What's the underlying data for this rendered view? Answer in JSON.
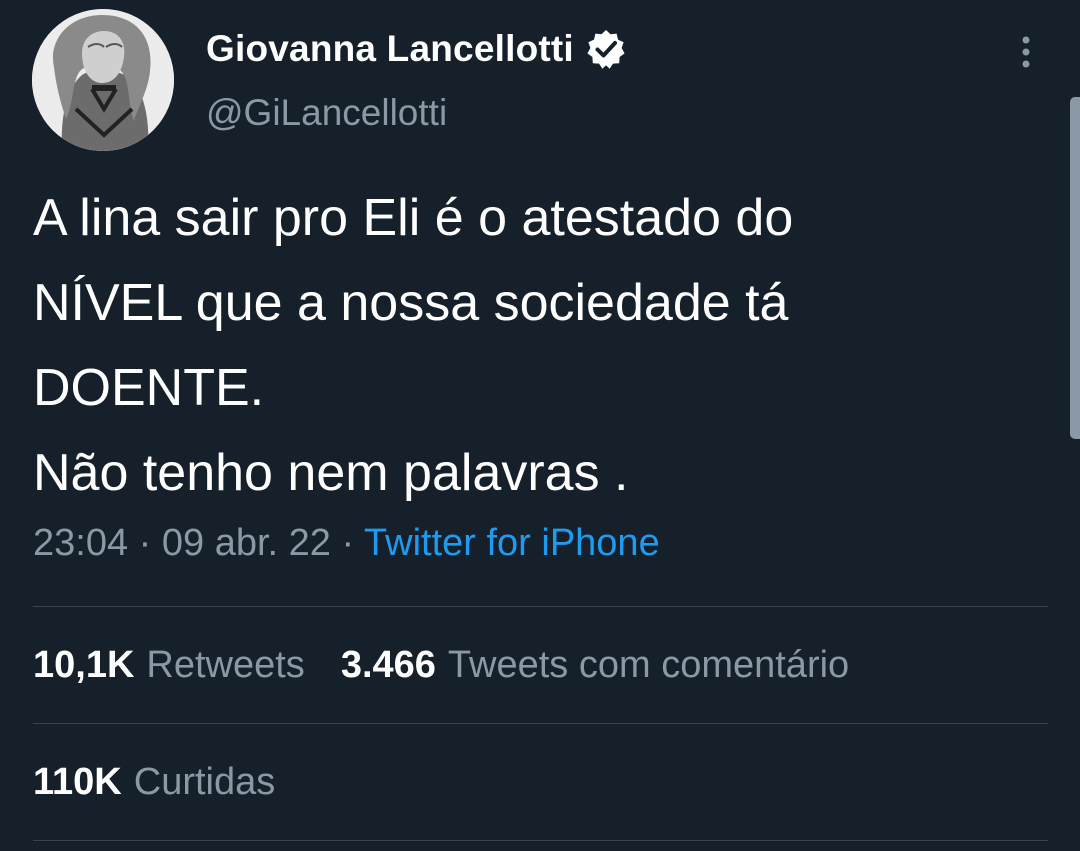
{
  "author": {
    "display_name": "Giovanna Lancellotti",
    "handle": "@GiLancellotti",
    "verified": true
  },
  "tweet": {
    "lines": [
      "A lina sair pro Eli é o atestado do",
      "NÍVEL que a nossa sociedade tá",
      "DOENTE.",
      "Não tenho nem palavras ."
    ],
    "time": "23:04",
    "date": "09 abr. 22",
    "separator": "·",
    "source": "Twitter for iPhone"
  },
  "stats": {
    "retweets_count": "10,1K",
    "retweets_label": "Retweets",
    "quotes_count": "3.466",
    "quotes_label": "Tweets com comentário",
    "likes_count": "110K",
    "likes_label": "Curtidas"
  },
  "colors": {
    "background": "#15202b",
    "secondary_text": "#8b98a5",
    "link": "#1d9bf0",
    "divider": "#38444d"
  },
  "icons": {
    "verified": "verified-badge-icon",
    "more": "more-vertical-icon"
  }
}
